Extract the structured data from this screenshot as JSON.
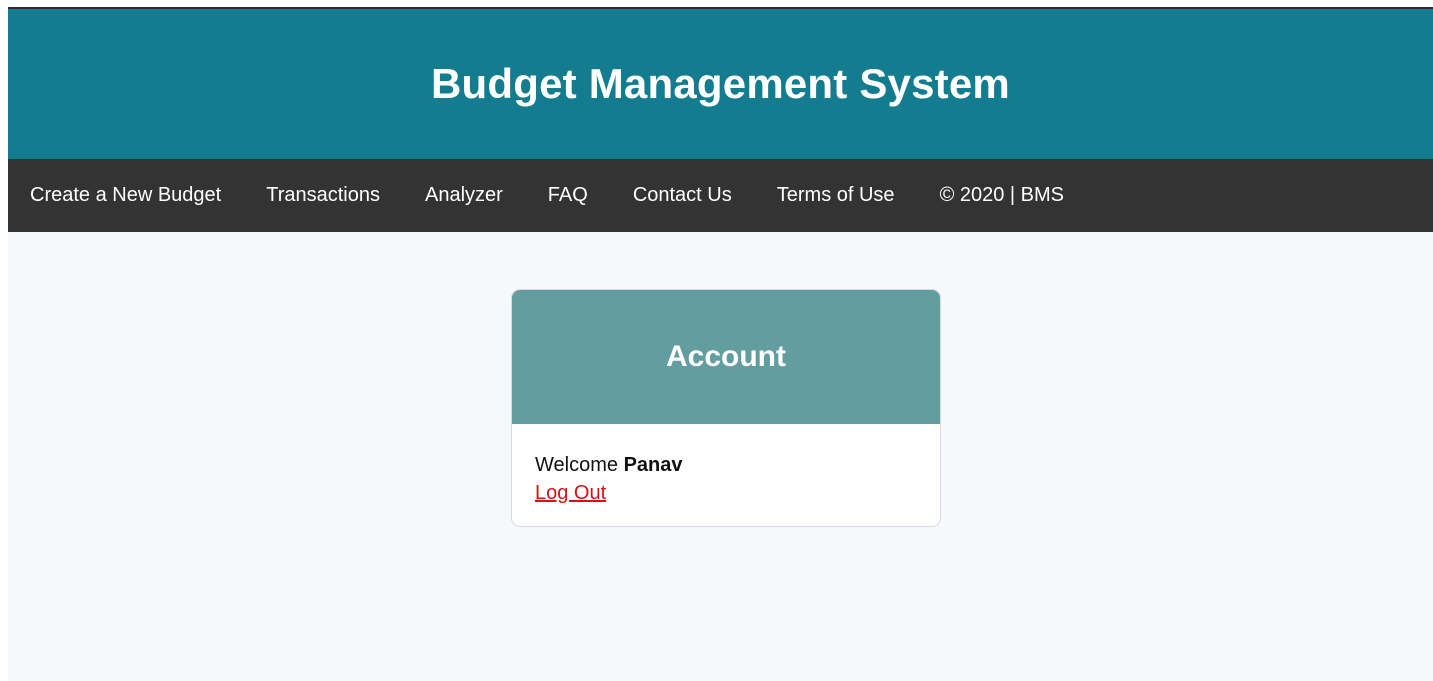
{
  "header": {
    "title": "Budget Management System"
  },
  "nav": {
    "items": [
      {
        "label": "Create a New Budget"
      },
      {
        "label": "Transactions"
      },
      {
        "label": "Analyzer"
      },
      {
        "label": "FAQ"
      },
      {
        "label": "Contact Us"
      },
      {
        "label": "Terms of Use"
      }
    ],
    "copyright": "© 2020 | BMS"
  },
  "account": {
    "title": "Account",
    "welcome_prefix": "Welcome",
    "username": "Panav",
    "logout_label": "Log Out"
  },
  "colors": {
    "header_bg": "#137c8e",
    "nav_bg": "#333333",
    "card_head_bg": "#629d9f",
    "logout_link": "#d41414",
    "page_bg": "#f6f8fc"
  }
}
